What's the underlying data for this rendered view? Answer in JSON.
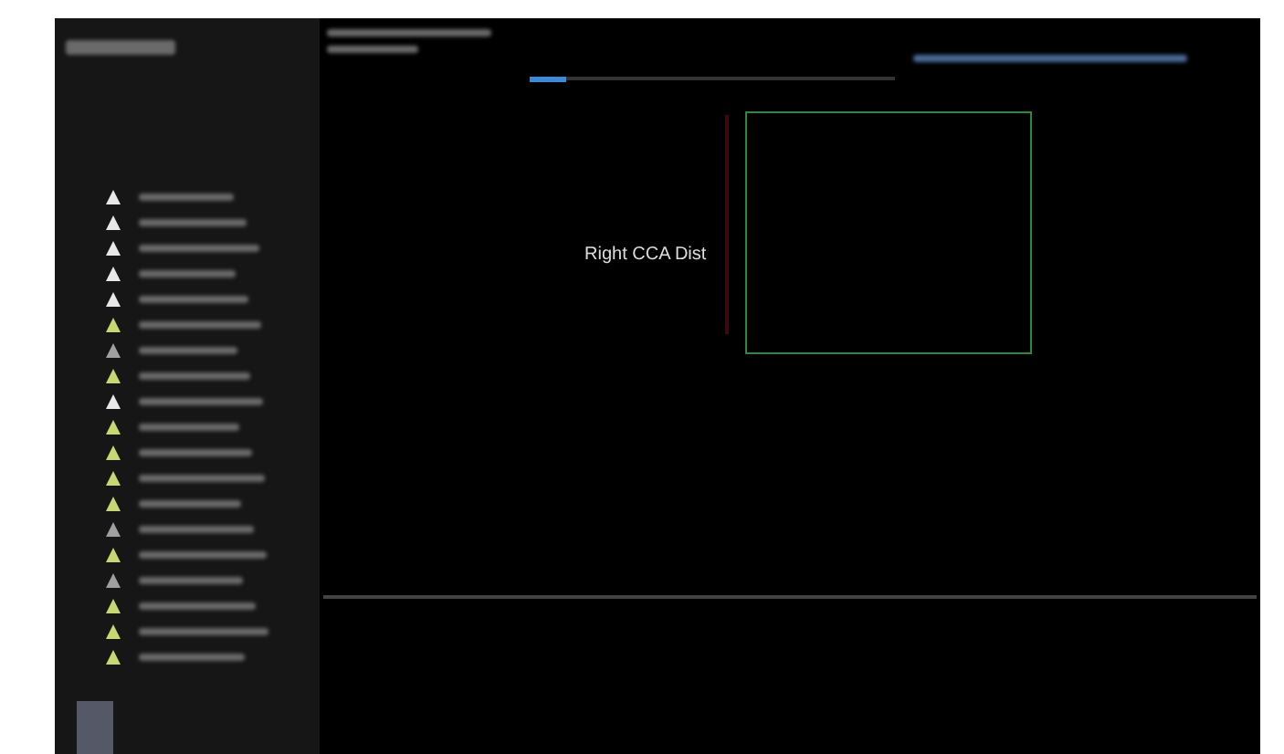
{
  "image_label": "Right CCA Dist",
  "measurements": [
    {
      "color": "#e8e8e8"
    },
    {
      "color": "#e8e8e8"
    },
    {
      "color": "#e8e8e8"
    },
    {
      "color": "#e8e8e8"
    },
    {
      "color": "#e8e8e8"
    },
    {
      "color": "#c8d870"
    },
    {
      "color": "#a0a0a0"
    },
    {
      "color": "#c8d870"
    },
    {
      "color": "#e8e8e8"
    },
    {
      "color": "#c8d870"
    },
    {
      "color": "#c8d870"
    },
    {
      "color": "#c8d870"
    },
    {
      "color": "#c8d870"
    },
    {
      "color": "#a0a0a0"
    },
    {
      "color": "#c8d870"
    },
    {
      "color": "#a0a0a0"
    },
    {
      "color": "#c8d870"
    },
    {
      "color": "#c8d870"
    },
    {
      "color": "#c8d870"
    }
  ],
  "scan_progress": {
    "level": 0.1
  }
}
